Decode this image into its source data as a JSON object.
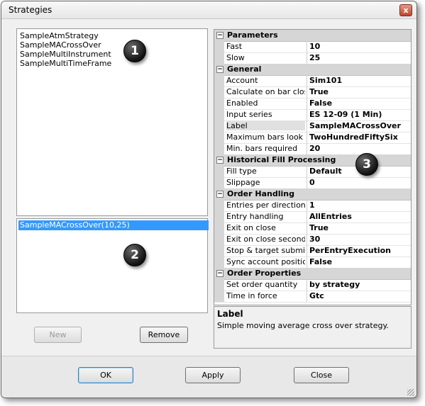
{
  "window": {
    "title": "Strategies",
    "close_glyph": "x"
  },
  "strategy_list": {
    "items": [
      "SampleAtmStrategy",
      "SampleMACrossOver",
      "SampleMultiInstrument",
      "SampleMultiTimeFrame"
    ]
  },
  "active_list": {
    "items": [
      "SampleMACrossOver(10,25)"
    ]
  },
  "badges": [
    "1",
    "2",
    "3"
  ],
  "buttons": {
    "new": "New",
    "remove": "Remove",
    "ok": "OK",
    "apply": "Apply",
    "close": "Close"
  },
  "properties": {
    "toggle_glyph": "−",
    "categories": [
      {
        "label": "Parameters",
        "rows": [
          {
            "name": "Fast",
            "value": "10"
          },
          {
            "name": "Slow",
            "value": "25"
          }
        ]
      },
      {
        "label": "General",
        "rows": [
          {
            "name": "Account",
            "value": "Sim101"
          },
          {
            "name": "Calculate on bar close",
            "value": "True"
          },
          {
            "name": "Enabled",
            "value": "False"
          },
          {
            "name": "Input series",
            "value": "ES 12-09 (1 Min)"
          },
          {
            "name": "Label",
            "value": "SampleMACrossOver"
          },
          {
            "name": "Maximum bars look back",
            "value": "TwoHundredFiftySix"
          },
          {
            "name": "Min. bars required",
            "value": "20"
          }
        ]
      },
      {
        "label": "Historical Fill Processing",
        "rows": [
          {
            "name": "Fill type",
            "value": "Default"
          },
          {
            "name": "Slippage",
            "value": "0"
          }
        ]
      },
      {
        "label": "Order Handling",
        "rows": [
          {
            "name": "Entries per direction",
            "value": "1"
          },
          {
            "name": "Entry handling",
            "value": "AllEntries"
          },
          {
            "name": "Exit on close",
            "value": "True"
          },
          {
            "name": "Exit on close seconds",
            "value": "30"
          },
          {
            "name": "Stop & target submission",
            "value": "PerEntryExecution"
          },
          {
            "name": "Sync account position",
            "value": "False"
          }
        ]
      },
      {
        "label": "Order Properties",
        "rows": [
          {
            "name": "Set order quantity",
            "value": "by strategy"
          },
          {
            "name": "Time in force",
            "value": "Gtc"
          }
        ]
      }
    ]
  },
  "description": {
    "title": "Label",
    "text": "Simple moving average cross over strategy."
  }
}
